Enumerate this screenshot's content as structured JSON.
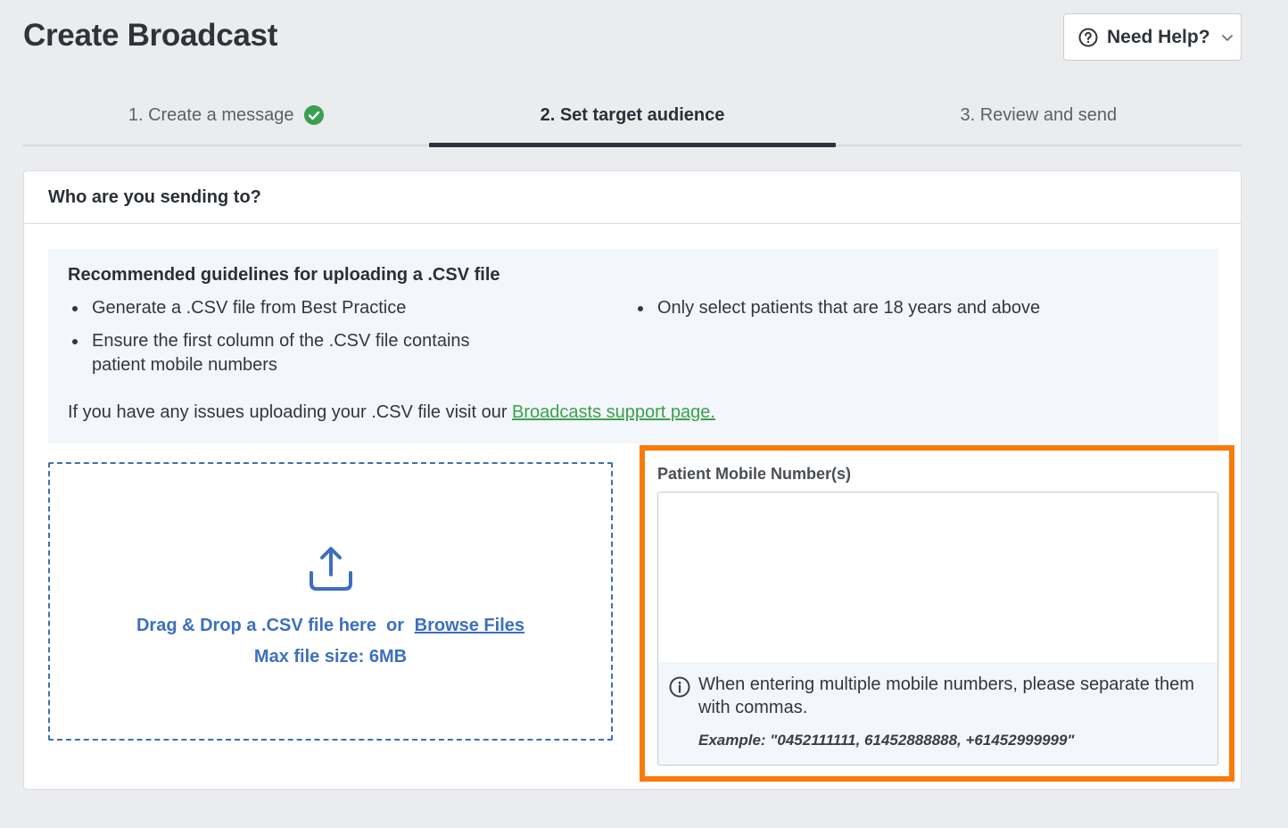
{
  "page": {
    "title": "Create Broadcast"
  },
  "help": {
    "label": "Need Help?"
  },
  "steps": [
    {
      "label": "1. Create a message",
      "state": "complete"
    },
    {
      "label": "2. Set target audience",
      "state": "active"
    },
    {
      "label": "3. Review and send",
      "state": "pending"
    }
  ],
  "card": {
    "title": "Who are you sending to?"
  },
  "guidelines": {
    "heading": "Recommended guidelines for uploading a .CSV file",
    "left_items": [
      "Generate a .CSV file from Best Practice",
      "Ensure the first column of the .CSV file contains patient mobile numbers"
    ],
    "right_items": [
      "Only select patients that are 18 years and above"
    ],
    "note_prefix": "If you have any issues uploading your .CSV file visit our",
    "note_link": "Broadcasts support page."
  },
  "dropzone": {
    "text": "Drag & Drop a .CSV file here  or",
    "browse_link": "Browse Files",
    "max_size": "Max file size: 6MB"
  },
  "phone": {
    "label": "Patient Mobile Number(s)",
    "value": "",
    "help_text": "When entering multiple mobile numbers, please separate them with commas.",
    "example": "Example: \"0452111111, 61452888888, +61452999999\""
  },
  "colors": {
    "accent_blue": "#3d6fc0",
    "success_green": "#3aa04e",
    "highlight_orange": "#fa7a05"
  }
}
